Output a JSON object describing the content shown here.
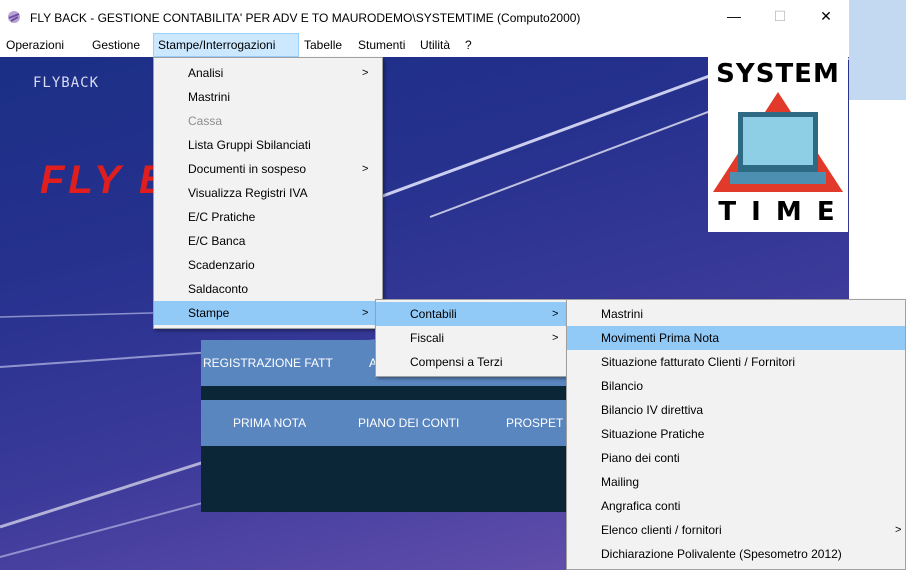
{
  "window": {
    "title": "FLY BACK - GESTIONE CONTABILITA' PER ADV E TO MAURODEMO\\SYSTEMTIME (Computo2000)",
    "minimize": "—",
    "maximize": "☐",
    "close": "✕"
  },
  "menubar": [
    "Operazioni",
    "Gestione",
    "Stampe/Interrogazioni",
    "Tabelle",
    "Stumenti",
    "Utilità",
    "?"
  ],
  "background": {
    "flyback_small": "FLYBACK",
    "flyback_big": "FLY B",
    "logo_top": "SYSTEM",
    "logo_bottom": "T I M E"
  },
  "panel": {
    "row1": [
      "REGISTRAZIONE FATT",
      "A"
    ],
    "row2": [
      "PRIMA NOTA",
      "PIANO DEI CONTI",
      "PROSPET"
    ]
  },
  "menu_stampe": {
    "items": [
      {
        "label": "Analisi",
        "submenu": true
      },
      {
        "label": "Mastrini"
      },
      {
        "label": "Cassa",
        "disabled": true
      },
      {
        "label": "Lista Gruppi Sbilanciati"
      },
      {
        "label": "Documenti in sospeso",
        "submenu": true
      },
      {
        "label": "Visualizza Registri IVA"
      },
      {
        "label": "E/C Pratiche"
      },
      {
        "label": "E/C Banca"
      },
      {
        "label": "Scadenzario"
      },
      {
        "label": "Saldaconto"
      },
      {
        "label": "Stampe",
        "submenu": true,
        "highlighted": true
      }
    ]
  },
  "menu_stampe_sub": {
    "items": [
      {
        "label": "Contabili",
        "submenu": true,
        "highlighted": true
      },
      {
        "label": "Fiscali",
        "submenu": true
      },
      {
        "label": "Compensi a Terzi"
      }
    ]
  },
  "menu_contabili": {
    "items": [
      {
        "label": "Mastrini"
      },
      {
        "label": "Movimenti Prima Nota",
        "highlighted": true
      },
      {
        "label": "Situazione fatturato Clienti / Fornitori"
      },
      {
        "label": "Bilancio"
      },
      {
        "label": "Bilancio IV direttiva"
      },
      {
        "label": "Situazione Pratiche"
      },
      {
        "label": "Piano dei conti"
      },
      {
        "label": "Mailing"
      },
      {
        "label": "Angrafica conti"
      },
      {
        "label": "Elenco clienti / fornitori",
        "submenu": true
      },
      {
        "label": "Dichiarazione Polivalente (Spesometro 2012)"
      }
    ]
  },
  "arrow_glyph": ">"
}
